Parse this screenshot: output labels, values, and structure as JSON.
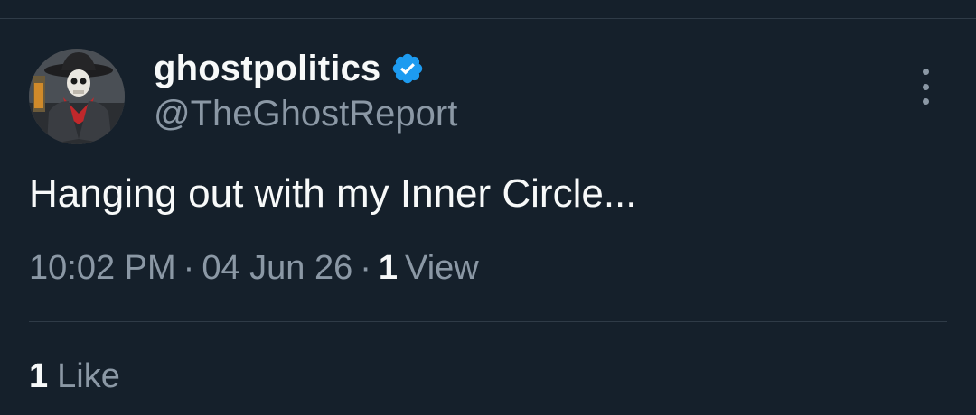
{
  "tweet": {
    "display_name": "ghostpolitics",
    "handle": "@TheGhostReport",
    "verified": true,
    "text": "Hanging out with my Inner Circle...",
    "time": "10:02 PM",
    "separator": "·",
    "date": "04 Jun 26",
    "views_count": "1",
    "views_label": "View",
    "likes_count": "1",
    "likes_label": "Like"
  },
  "icons": {
    "verified": "verified-badge-icon",
    "more": "more-vertical-icon"
  },
  "colors": {
    "background": "#15202b",
    "primary_text": "#f7f9f9",
    "secondary_text": "#8b98a5",
    "verified_blue": "#1d9bf0",
    "divider": "#2f3b47"
  }
}
